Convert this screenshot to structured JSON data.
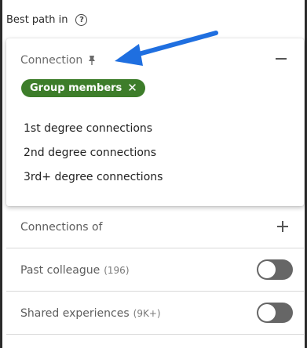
{
  "header": {
    "title": "Best path in",
    "help_glyph": "?"
  },
  "connection": {
    "label": "Connection",
    "chip_label": "Group members",
    "chip_close_glyph": "✕",
    "options": [
      "1st degree connections",
      "2nd degree connections",
      "3rd+ degree connections"
    ]
  },
  "rows": {
    "connections_of": "Connections of",
    "past_colleague": {
      "label": "Past colleague",
      "count": "(196)",
      "enabled": false
    },
    "shared_experiences": {
      "label": "Shared experiences",
      "count": "(9K+)",
      "enabled": false
    }
  },
  "colors": {
    "chip": "#3d7d2a",
    "arrow": "#1f6fe0",
    "toggle_off": "#666666"
  },
  "icons": {
    "pin": "pin-icon",
    "help": "help-icon",
    "collapse": "minus-icon",
    "add": "plus-icon",
    "annotation": "arrow-icon"
  }
}
